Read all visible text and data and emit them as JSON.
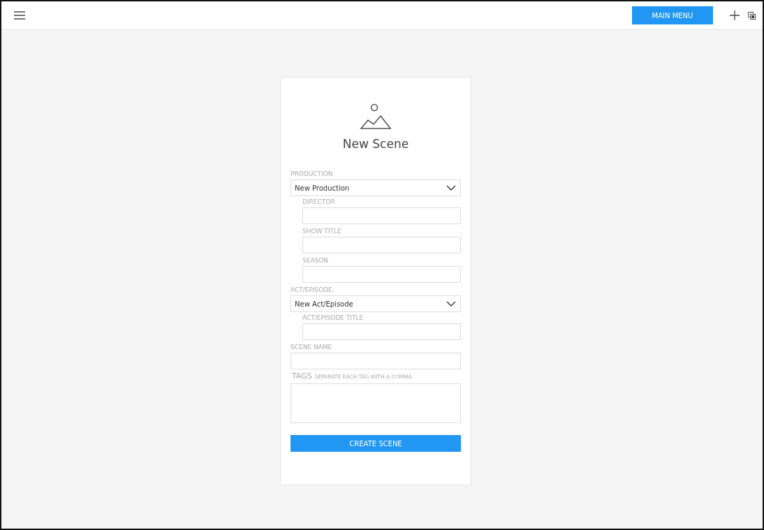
{
  "top_bar": {
    "main_menu_button": "MAIN MENU"
  },
  "form": {
    "title": "New Scene",
    "fields": [
      {
        "kind": "select",
        "label": "PRODUCTION",
        "value": "New Production",
        "children": [
          {
            "kind": "text",
            "label": "DIRECTOR"
          },
          {
            "kind": "text",
            "label": "SHOW TITLE"
          },
          {
            "kind": "text",
            "label": "SEASON"
          }
        ]
      },
      {
        "kind": "select",
        "label": "ACT/EPISODE",
        "value": "New Act/Episode",
        "children": [
          {
            "kind": "text",
            "label": "ACT/EPISODE TITLE"
          }
        ]
      },
      {
        "kind": "text",
        "label": "SCENE NAME"
      },
      {
        "kind": "textarea",
        "label": "TAGS",
        "hint": "SEPARATE EACH TAG WITH A COMMA"
      }
    ],
    "submit_button": "CREATE SCENE"
  }
}
